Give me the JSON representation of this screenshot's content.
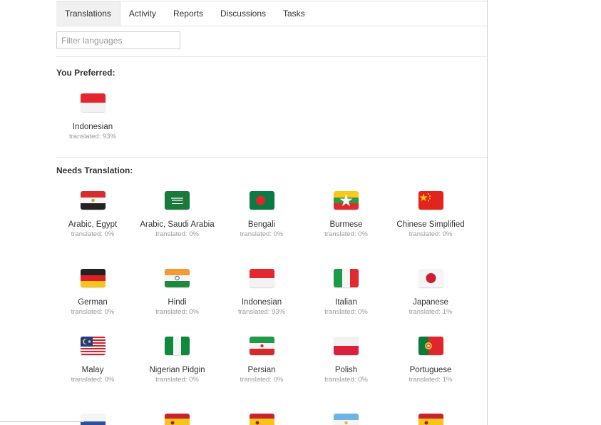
{
  "tabs": [
    {
      "label": "Translations",
      "active": true
    },
    {
      "label": "Activity"
    },
    {
      "label": "Reports"
    },
    {
      "label": "Discussions"
    },
    {
      "label": "Tasks"
    }
  ],
  "filter": {
    "placeholder": "Filter languages",
    "value": ""
  },
  "preferred": {
    "title": "You Preferred:",
    "items": [
      {
        "name": "Indonesian",
        "status": "translated: 93%",
        "flag": "indonesia-flag"
      }
    ]
  },
  "needs": {
    "title": "Needs Translation:",
    "items": [
      {
        "name": "Arabic, Egypt",
        "status": "translated: 0%",
        "flag": "egypt-flag"
      },
      {
        "name": "Arabic, Saudi Arabia",
        "status": "translated: 0%",
        "flag": "saudi-arabia-flag"
      },
      {
        "name": "Bengali",
        "status": "translated: 0%",
        "flag": "bangladesh-flag"
      },
      {
        "name": "Burmese",
        "status": "translated: 0%",
        "flag": "myanmar-flag"
      },
      {
        "name": "Chinese Simplified",
        "status": "translated: 0%",
        "flag": "china-flag"
      },
      {
        "name": "German",
        "status": "translated: 0%",
        "flag": "germany-flag"
      },
      {
        "name": "Hindi",
        "status": "translated: 0%",
        "flag": "india-flag"
      },
      {
        "name": "Indonesian",
        "status": "translated: 93%",
        "flag": "indonesia-flag"
      },
      {
        "name": "Italian",
        "status": "translated: 0%",
        "flag": "italy-flag"
      },
      {
        "name": "Japanese",
        "status": "translated: 1%",
        "flag": "japan-flag"
      },
      {
        "name": "Malay",
        "status": "translated: 0%",
        "flag": "malaysia-flag"
      },
      {
        "name": "Nigerian Pidgin",
        "status": "translated: 0%",
        "flag": "nigeria-flag"
      },
      {
        "name": "Persian",
        "status": "translated: 0%",
        "flag": "iran-flag"
      },
      {
        "name": "Polish",
        "status": "translated: 0%",
        "flag": "poland-flag"
      },
      {
        "name": "Portuguese",
        "status": "translated: 1%",
        "flag": "portugal-flag"
      },
      {
        "name": "",
        "status": "",
        "flag": "partial-flag-blue"
      },
      {
        "name": "",
        "status": "",
        "flag": "spain-flag"
      },
      {
        "name": "",
        "status": "",
        "flag": "spain-flag"
      },
      {
        "name": "",
        "status": "",
        "flag": "argentina-flag"
      },
      {
        "name": "",
        "status": "",
        "flag": "spain-flag"
      }
    ]
  },
  "colors": {
    "accent": "#333333",
    "muted": "#999999",
    "border": "#e3e3e3"
  }
}
